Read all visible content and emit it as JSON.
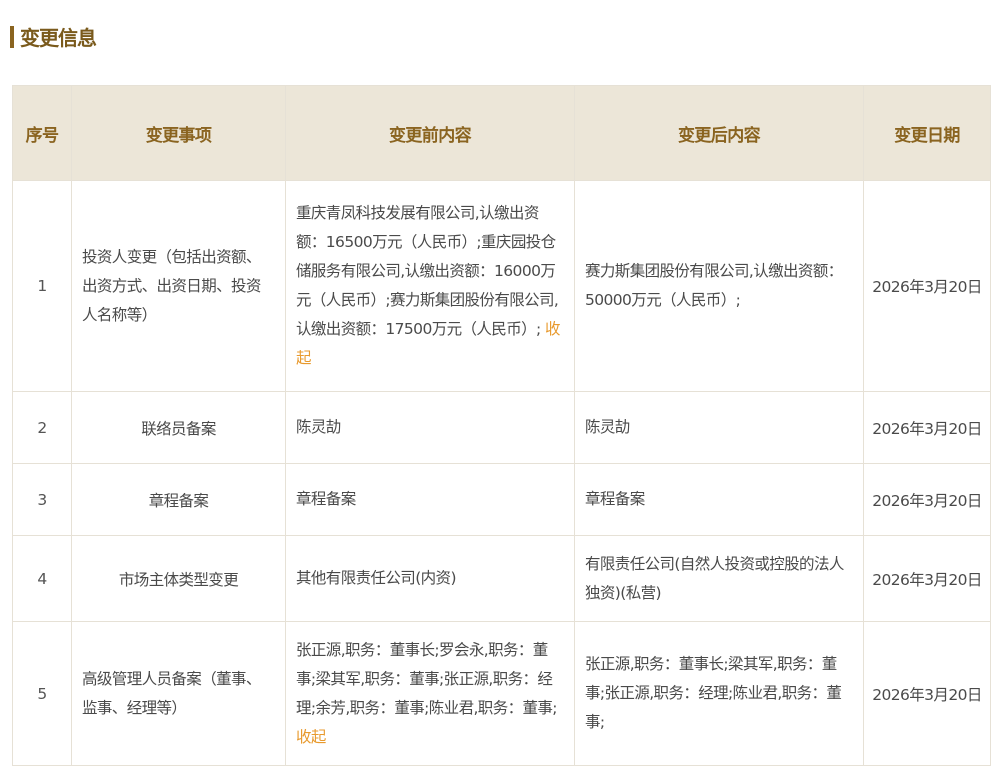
{
  "section": {
    "title": "变更信息"
  },
  "table": {
    "headers": [
      "序号",
      "变更事项",
      "变更前内容",
      "变更后内容",
      "变更日期"
    ],
    "rows": [
      {
        "index": "1",
        "item": "投资人变更（包括出资额、出资方式、出资日期、投资人名称等）",
        "before": "重庆青凤科技发展有限公司,认缴出资额：16500万元（人民币）;重庆园投仓储服务有限公司,认缴出资额：16000万元（人民币）;赛力斯集团股份有限公司,认缴出资额：17500万元（人民币）;",
        "before_toggle": "收起",
        "after": "赛力斯集团股份有限公司,认缴出资额：50000万元（人民币）;",
        "date": "2026年3月20日"
      },
      {
        "index": "2",
        "item": "联络员备案",
        "before": "陈灵劼",
        "after": "陈灵劼",
        "date": "2026年3月20日"
      },
      {
        "index": "3",
        "item": "章程备案",
        "before": "章程备案",
        "after": "章程备案",
        "date": "2026年3月20日"
      },
      {
        "index": "4",
        "item": "市场主体类型变更",
        "before": "其他有限责任公司(内资)",
        "after": "有限责任公司(自然人投资或控股的法人独资)(私营)",
        "date": "2026年3月20日"
      },
      {
        "index": "5",
        "item": "高级管理人员备案（董事、监事、经理等）",
        "before": "张正源,职务：董事长;罗会永,职务：董事;梁其军,职务：董事;张正源,职务：经理;余芳,职务：董事;陈业君,职务：董事;",
        "before_toggle": "收起",
        "after": "张正源,职务：董事长;梁其军,职务：董事;张正源,职务：经理;陈业君,职务：董事;",
        "date": "2026年3月20日"
      }
    ]
  }
}
